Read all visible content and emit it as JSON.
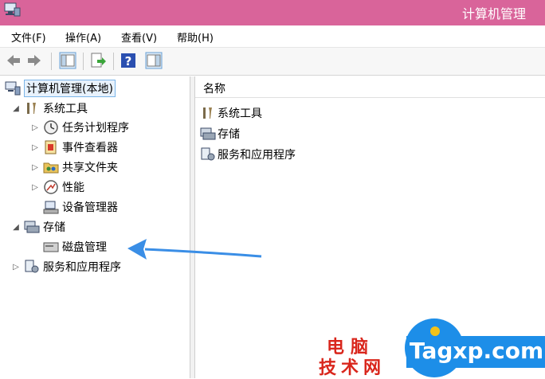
{
  "window": {
    "title": "计算机管理"
  },
  "menu": {
    "items": [
      "文件(F)",
      "操作(A)",
      "查看(V)",
      "帮助(H)"
    ]
  },
  "toolbar": {
    "icons": [
      "back-arrow-icon",
      "forward-arrow-icon",
      "show-hide-tree-icon",
      "export-list-icon",
      "help-icon",
      "properties-icon"
    ]
  },
  "tree": {
    "root": "计算机管理(本地)",
    "system_tools": "系统工具",
    "task_scheduler": "任务计划程序",
    "event_viewer": "事件查看器",
    "shared_folders": "共享文件夹",
    "performance": "性能",
    "device_manager": "设备管理器",
    "storage": "存储",
    "disk_management": "磁盘管理",
    "services_apps": "服务和应用程序"
  },
  "list": {
    "header": "名称",
    "items": [
      "系统工具",
      "存储",
      "服务和应用程序"
    ]
  },
  "watermark": {
    "line1": "电脑",
    "line2": "技术网",
    "latin": "Tagxp.com"
  },
  "colors": {
    "titlebar": "#d9649a",
    "arrow": "#3a8ee6",
    "watermark_red": "#d9261c",
    "watermark_blue": "#1d8ee8"
  }
}
